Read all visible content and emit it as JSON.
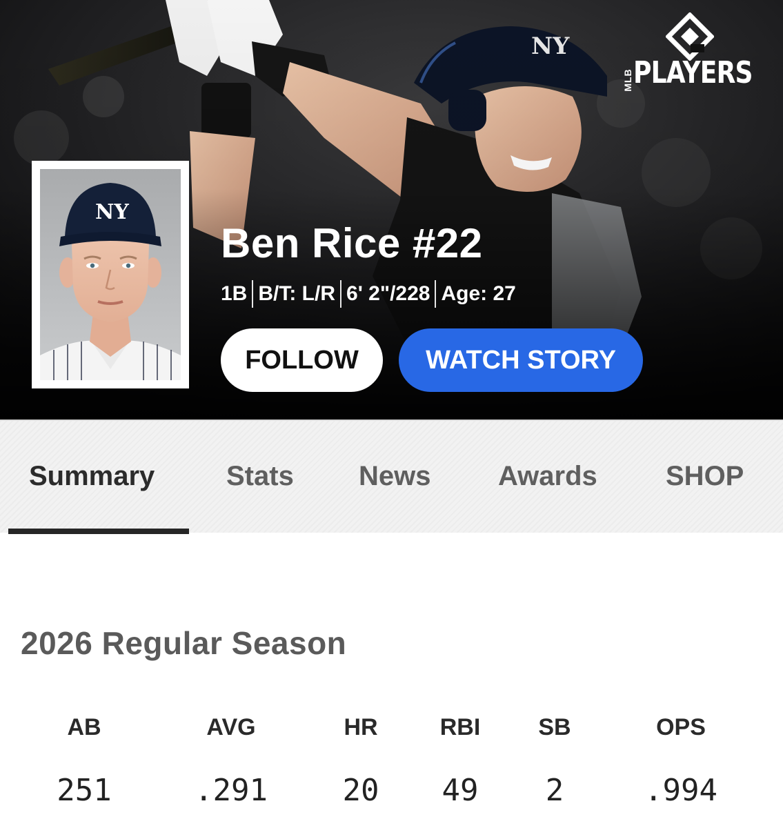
{
  "brand": {
    "mark_icon": "mlb-players-shield-icon",
    "small_text": "MLB",
    "text": "PLAYERS"
  },
  "player": {
    "name": "Ben Rice #22",
    "bio": [
      "1B",
      "B/T: L/R",
      "6' 2\"/228",
      "Age: 27"
    ]
  },
  "buttons": {
    "follow": "FOLLOW",
    "watch_story": "WATCH STORY"
  },
  "tabs": [
    {
      "label": "Summary",
      "active": true
    },
    {
      "label": "Stats",
      "active": false
    },
    {
      "label": "News",
      "active": false
    },
    {
      "label": "Awards",
      "active": false
    },
    {
      "label": "SHOP",
      "active": false
    }
  ],
  "season": {
    "title": "2026 Regular Season",
    "stats": [
      {
        "label": "AB",
        "value": "251"
      },
      {
        "label": "AVG",
        "value": ".291"
      },
      {
        "label": "HR",
        "value": "20"
      },
      {
        "label": "RBI",
        "value": "49"
      },
      {
        "label": "SB",
        "value": "2"
      },
      {
        "label": "OPS",
        "value": ".994"
      }
    ]
  },
  "colors": {
    "accent": "#2868e5",
    "hero_bg": "#0d0d0d",
    "tab_bg": "#f2f2f2",
    "tab_indicator": "#262626"
  }
}
